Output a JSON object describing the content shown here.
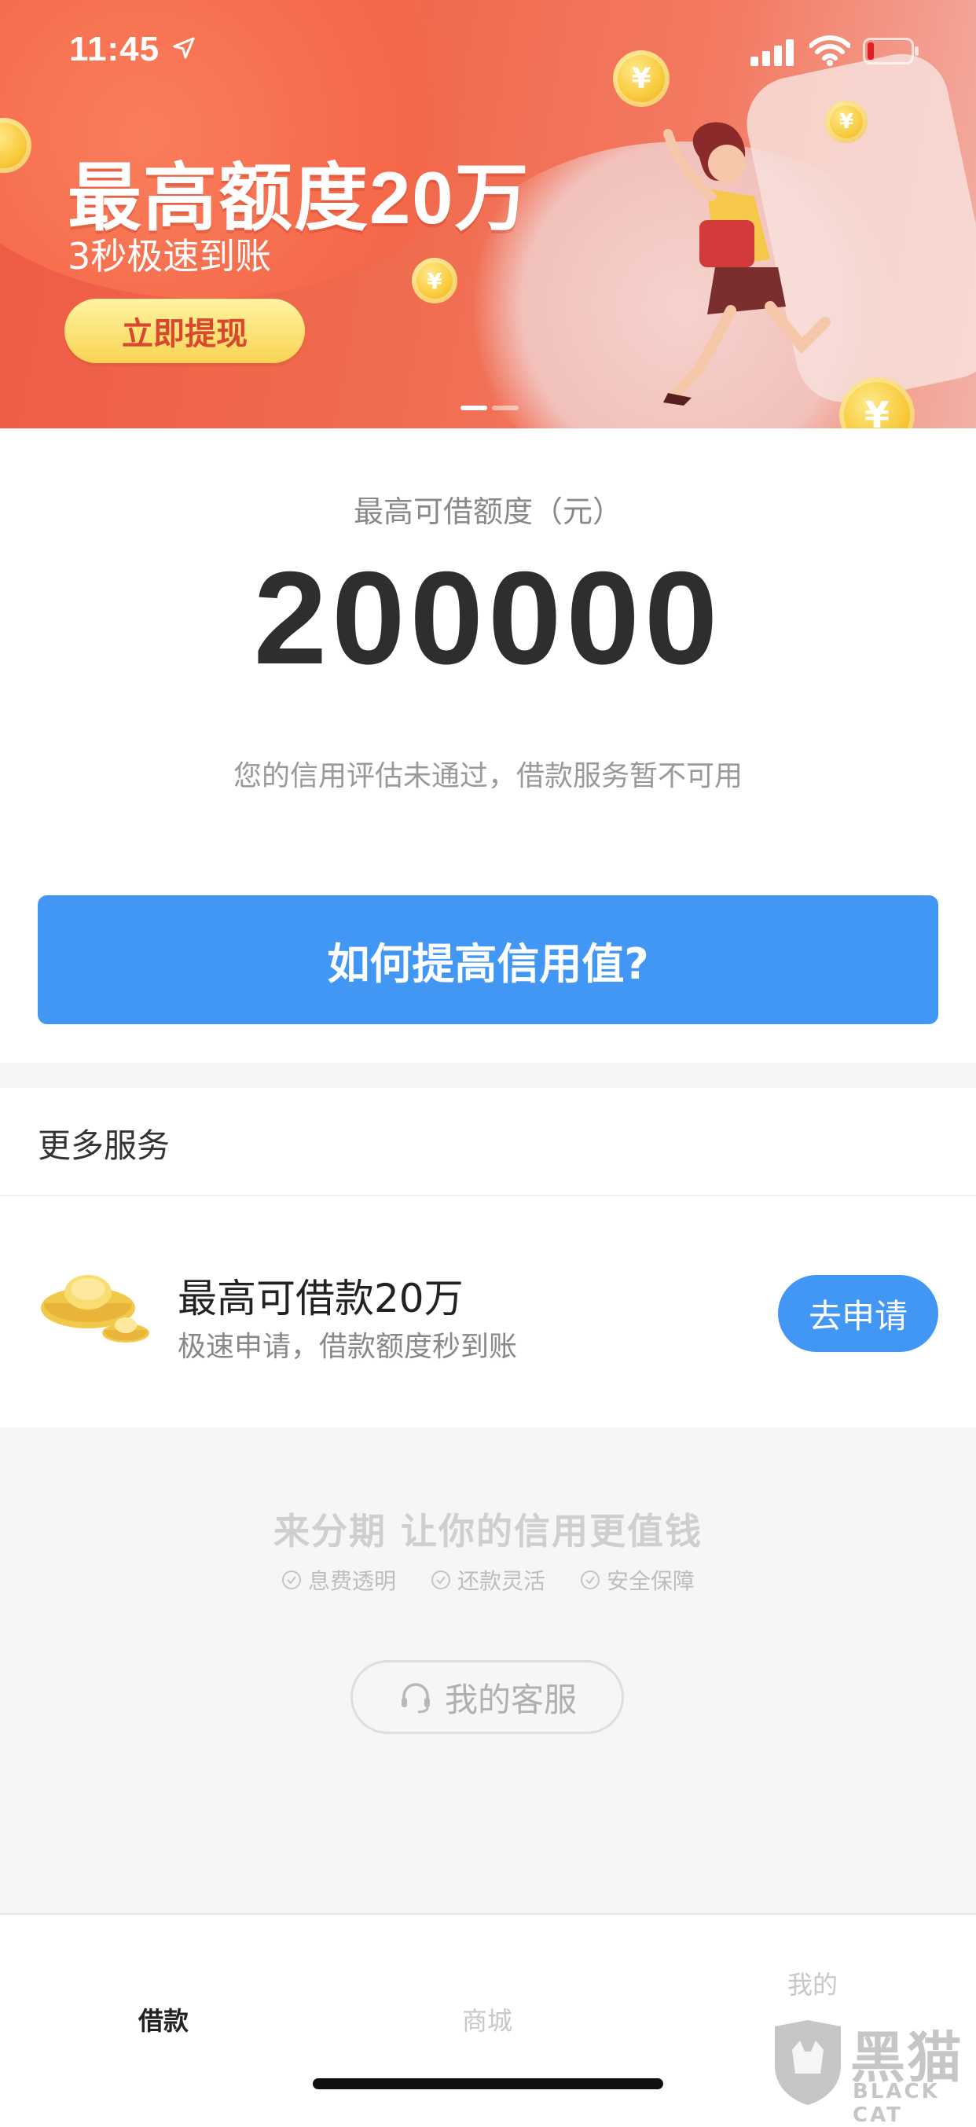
{
  "status_bar": {
    "time": "11:45"
  },
  "banner": {
    "headline": "最高额度20万",
    "subline": "3秒极速到账",
    "cta_label": "立即提现",
    "coin_symbol": "¥",
    "active_slide": 1,
    "slide_count": 2
  },
  "credit": {
    "label": "最高可借额度（元）",
    "amount": "200000",
    "status_text": "您的信用评估未通过，借款服务暂不可用",
    "improve_button": "如何提高信用值?"
  },
  "more_services": {
    "title": "更多服务",
    "item": {
      "title": "最高可借款20万",
      "subtitle": "极速申请，借款额度秒到账",
      "button": "去申请",
      "icon": "gold-ingot-icon"
    }
  },
  "footer": {
    "slogan": "来分期  让你的信用更值钱",
    "features": [
      "息费透明",
      "还款灵活",
      "安全保障"
    ],
    "service_button": "我的客服"
  },
  "tab_bar": {
    "tabs": [
      {
        "label": "借款",
        "active": true
      },
      {
        "label": "商城",
        "active": false
      },
      {
        "label": "我的",
        "active": false
      }
    ]
  },
  "watermark": {
    "cn": "黑猫",
    "en": "BLACK CAT"
  },
  "colors": {
    "primary": "#4297f4",
    "banner_red": "#ef5a45",
    "cta_gold": "#f9d453",
    "tab_active": "#222222",
    "tab_inactive": "#c8c8c8"
  }
}
